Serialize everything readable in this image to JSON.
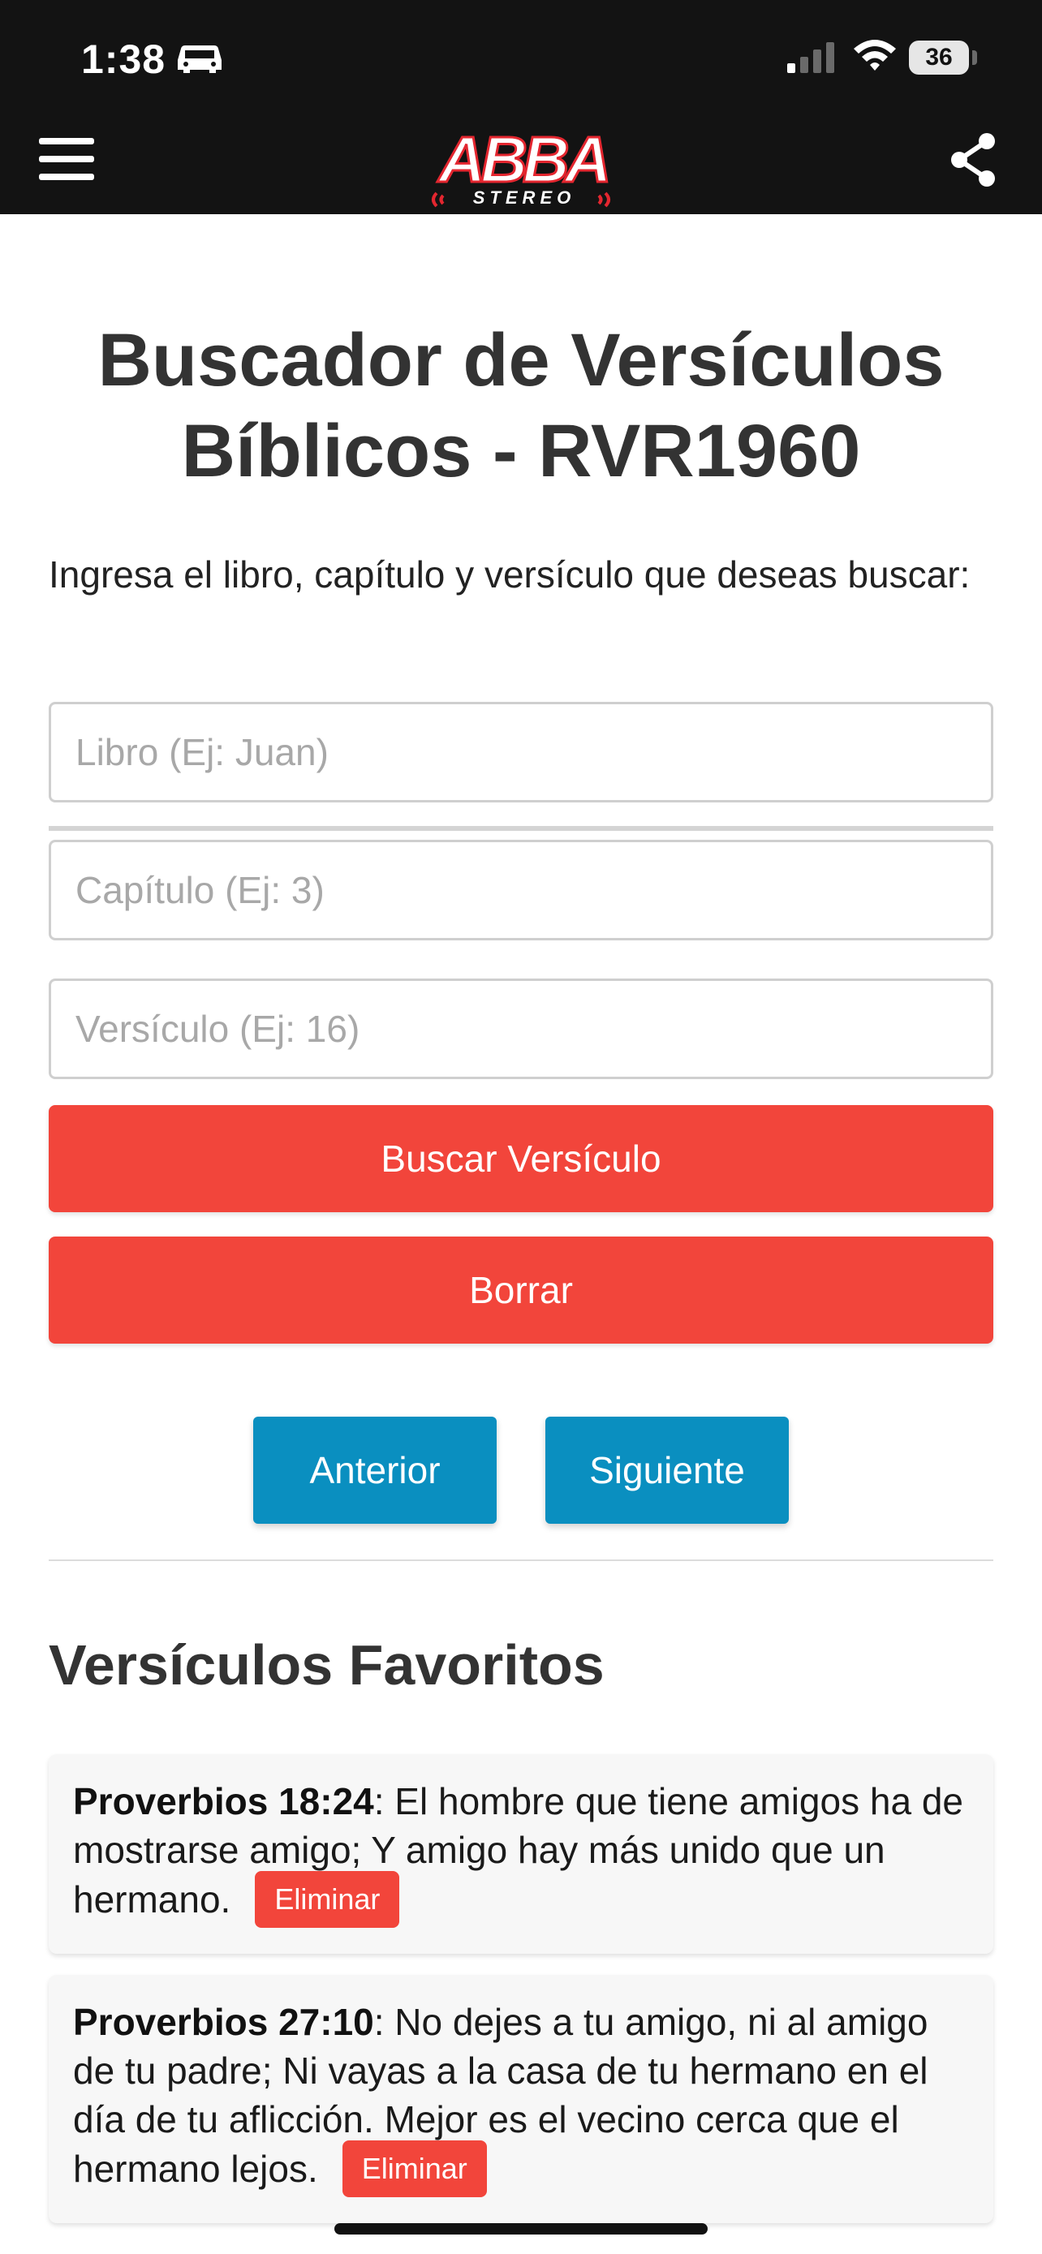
{
  "status_bar": {
    "time": "1:38",
    "battery": "36"
  },
  "app_bar": {
    "logo_main": "ABBA",
    "logo_sub": "STEREO"
  },
  "page": {
    "title": "Buscador de Versículos Bíblicos - RVR1960",
    "instructions": "Ingresa el libro, capítulo y versículo que deseas buscar:"
  },
  "form": {
    "book_placeholder": "Libro (Ej: Juan)",
    "chapter_placeholder": "Capítulo (Ej: 3)",
    "verse_placeholder": "Versículo (Ej: 16)",
    "search_label": "Buscar Versículo",
    "clear_label": "Borrar"
  },
  "navigation": {
    "previous_label": "Anterior",
    "next_label": "Siguiente"
  },
  "favorites": {
    "title": "Versículos Favoritos",
    "items": [
      {
        "reference": "Proverbios 18:24",
        "text": ": El hombre que tiene amigos ha de mostrarse amigo; Y amigo hay más unido que un hermano.",
        "delete_label": "Eliminar"
      },
      {
        "reference": "Proverbios 27:10",
        "text": ": No dejes a tu amigo, ni al amigo de tu padre; Ni vayas a la casa de tu hermano en el día de tu aflicción. Mejor es el vecino cerca que el hermano lejos.",
        "delete_label": "Eliminar"
      }
    ]
  },
  "colors": {
    "header_bg": "#131313",
    "primary_red": "#f2453b",
    "nav_blue": "#0a8fc0"
  }
}
